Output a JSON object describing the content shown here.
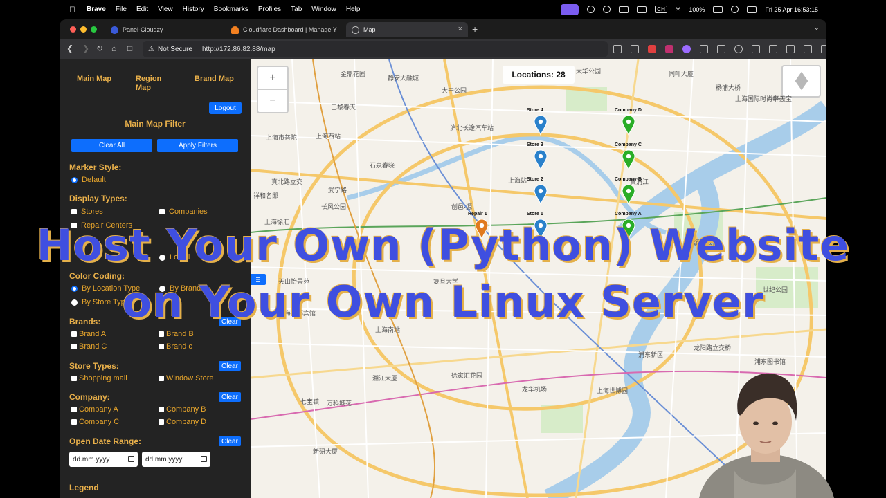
{
  "menubar": {
    "app": "Brave",
    "items": [
      "File",
      "Edit",
      "View",
      "History",
      "Bookmarks",
      "Profiles",
      "Tab",
      "Window",
      "Help"
    ],
    "battery": "100%",
    "input_source": "CH",
    "datetime": "Fri 25 Apr  16:53:15"
  },
  "tabs": [
    {
      "label": "Panel-Cloudzy",
      "active": false
    },
    {
      "label": "Cloudflare Dashboard | Manage Y",
      "active": false
    },
    {
      "label": "Map",
      "active": true
    }
  ],
  "addressbar": {
    "security": "Not Secure",
    "url": "http://172.86.82.88/map"
  },
  "panel": {
    "nav": [
      "Main Map",
      "Region Map",
      "Brand Map"
    ],
    "logout": "Logout",
    "filter_title": "Main Map Filter",
    "clear_all": "Clear All",
    "apply": "Apply Filters",
    "marker_style": {
      "title": "Marker Style:",
      "options": [
        "Default"
      ]
    },
    "display_types": {
      "title": "Display Types:",
      "options": [
        "Stores",
        "Companies",
        "Repair Centers"
      ]
    },
    "display_mode_partial": "Locati",
    "color_coding": {
      "title": "Color Coding:",
      "options": [
        "By Location Type",
        "By Brand",
        "By Store Typ"
      ]
    },
    "brands": {
      "title": "Brands:",
      "clear": "Clear",
      "options": [
        "Brand A",
        "Brand B",
        "Brand C",
        "Brand c"
      ]
    },
    "store_types": {
      "title": "Store Types:",
      "clear": "Clear",
      "options": [
        "Shopping mall",
        "Window Store"
      ]
    },
    "company": {
      "title": "Company:",
      "clear": "Clear",
      "options": [
        "Company A",
        "Company B",
        "Company C",
        "Company D"
      ]
    },
    "open_date": {
      "title": "Open Date Range:",
      "clear": "Clear",
      "placeholder": "dd.mm.yyyy"
    },
    "legend": "Legend"
  },
  "map": {
    "zoom_in": "+",
    "zoom_out": "−",
    "locations_label": "Locations: 28",
    "markers": [
      {
        "label": "Store 4",
        "color": "#2a81cb"
      },
      {
        "label": "Store 3",
        "color": "#2a81cb"
      },
      {
        "label": "Store 2",
        "color": "#2a81cb"
      },
      {
        "label": "Store 1",
        "color": "#2a81cb"
      },
      {
        "label": "Company D",
        "color": "#2aad27"
      },
      {
        "label": "Company C",
        "color": "#2aad27"
      },
      {
        "label": "Company B",
        "color": "#2aad27"
      },
      {
        "label": "Company A",
        "color": "#2aad27"
      },
      {
        "label": "Repair 1",
        "color": "#e07a1f"
      }
    ],
    "place_labels": [
      "金鼎花园",
      "静安大融城",
      "大宁公园",
      "大华公园",
      "巴黎春天",
      "上海西站",
      "沪北长途汽车站",
      "上海市普陀",
      "石泉春晓",
      "真北路立交",
      "武宁路",
      "长风公园",
      "上海站",
      "祥和名邸",
      "创邑·源",
      "源深公园",
      "上海徐汇",
      "天山怡景苑",
      "上海西郊宾馆",
      "世纪公园",
      "黄浦江",
      "上海南站",
      "徐家汇花园",
      "龙华机场",
      "上海世博园",
      "浦东新区",
      "万科城花",
      "湘江大厦",
      "七宝镇",
      "新研大厦",
      "上海市闵行区",
      "同叶大厦",
      "杨浦大桥",
      "中环天宝",
      "上海国际时尚中心",
      "复旦大学",
      "龙阳路立交桥",
      "浦东图书馆"
    ]
  },
  "overlay": {
    "line1": "Host Your Own (Python) Website",
    "line2": "on Your Own Linux Server"
  }
}
